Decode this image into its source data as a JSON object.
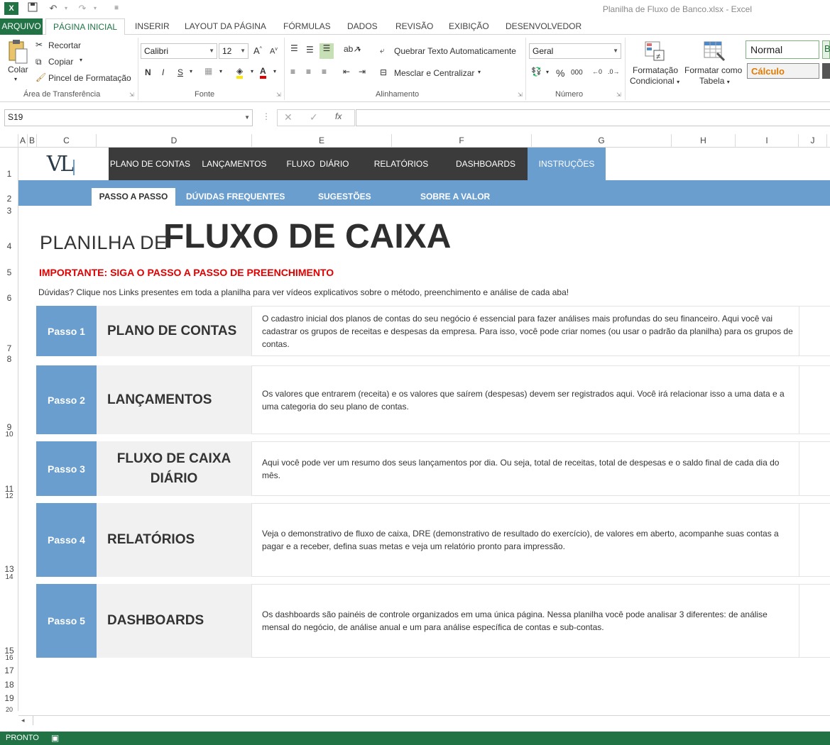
{
  "window": {
    "title": "Planilha de Fluxo de Banco.xlsx - Excel"
  },
  "ribbon_tabs": [
    {
      "label": "ARQUIVO"
    },
    {
      "label": "PÁGINA INICIAL"
    },
    {
      "label": "INSERIR"
    },
    {
      "label": "LAYOUT DA PÁGINA"
    },
    {
      "label": "FÓRMULAS"
    },
    {
      "label": "DADOS"
    },
    {
      "label": "REVISÃO"
    },
    {
      "label": "EXIBIÇÃO"
    },
    {
      "label": "DESENVOLVEDOR"
    }
  ],
  "clipboard": {
    "paste": "Colar",
    "cut": "Recortar",
    "copy": "Copiar",
    "format_painter": "Pincel de Formatação",
    "group": "Área de Transferência"
  },
  "font": {
    "name": "Calibri",
    "size": "12",
    "bold": "N",
    "italic": "I",
    "underline": "S",
    "group": "Fonte"
  },
  "alignment": {
    "wrap": "Quebrar Texto Automaticamente",
    "merge": "Mesclar e Centralizar",
    "group": "Alinhamento"
  },
  "number": {
    "format": "Geral",
    "percent": "%",
    "thousands": "000",
    "group": "Número"
  },
  "styles": {
    "conditional": [
      "Formatação",
      "Condicional"
    ],
    "table": [
      "Formatar como",
      "Tabela"
    ],
    "normal": "Normal",
    "calc": "Cálculo"
  },
  "formula_bar": {
    "name_box": "S19",
    "fx": "fx"
  },
  "columns": [
    "A",
    "B",
    "C",
    "D",
    "E",
    "F",
    "G",
    "H",
    "I",
    "J"
  ],
  "rows": [
    "1",
    "2",
    "3",
    "4",
    "5",
    "6",
    "7",
    "8",
    "9",
    "10",
    "11",
    "12",
    "13",
    "14",
    "15",
    "16",
    "17",
    "18",
    "19",
    "20"
  ],
  "sheet": {
    "logo_text": "VL",
    "nav_main": [
      "PLANO DE CONTAS",
      "LANÇAMENTOS",
      "FLUXO  DIÁRIO",
      "RELATÓRIOS",
      "DASHBOARDS"
    ],
    "nav_main_active": "INSTRUÇÕES",
    "nav_sub_active": "PASSO A PASSO",
    "nav_sub": [
      "DÚVIDAS FREQUENTES",
      "SUGESTÕES",
      "SOBRE A VALOR"
    ],
    "title_small": "PLANILHA DE",
    "title_big": "FLUXO DE CAIXA",
    "important": "IMPORTANTE: SIGA O PASSO A PASSO DE PREENCHIMENTO",
    "help": "Dúvidas? Clique nos Links presentes em toda a planilha para ver vídeos explicativos sobre o método, preenchimento e análise de cada aba!",
    "steps": [
      {
        "num": "Passo 1",
        "name": "PLANO DE CONTAS",
        "desc": "O cadastro inicial dos planos de contas do seu negócio é essencial para fazer análises mais profundas do seu financeiro. Aqui você vai cadastrar os grupos de receitas e despesas da empresa. Para isso, você pode criar nomes (ou usar o padrão da planilha) para os grupos de contas."
      },
      {
        "num": "Passo 2",
        "name": "LANÇAMENTOS",
        "desc": "Os valores que entrarem (receita) e os valores que saírem (despesas) devem ser registrados aqui. Você irá relacionar isso a uma data e a uma categoria do seu plano de contas."
      },
      {
        "num": "Passo 3",
        "name": "FLUXO DE CAIXA DIÁRIO",
        "desc": "Aqui você pode ver um resumo dos seus lançamentos por dia. Ou seja, total de receitas, total de despesas e o saldo final de cada dia do mês."
      },
      {
        "num": "Passo 4",
        "name": "RELATÓRIOS",
        "desc": "Veja o demonstrativo de fluxo de caixa, DRE (demonstrativo de resultado do exercício), de valores em aberto, acompanhe suas contas a pagar e a receber, defina suas metas e veja um relatório pronto para impressão."
      },
      {
        "num": "Passo 5",
        "name": "DASHBOARDS",
        "desc": "Os dashboards são painéis de controle organizados em uma única página. Nessa planilha você pode analisar 3 diferentes: de análise mensal do negócio, de análise anual e um para análise específica de contas e sub-contas."
      }
    ]
  },
  "status": {
    "ready": "PRONTO"
  },
  "colors": {
    "excel_green": "#217346",
    "nav_dark": "#3b3b3b",
    "nav_blue": "#6a9ecf",
    "important_red": "#e00000"
  }
}
